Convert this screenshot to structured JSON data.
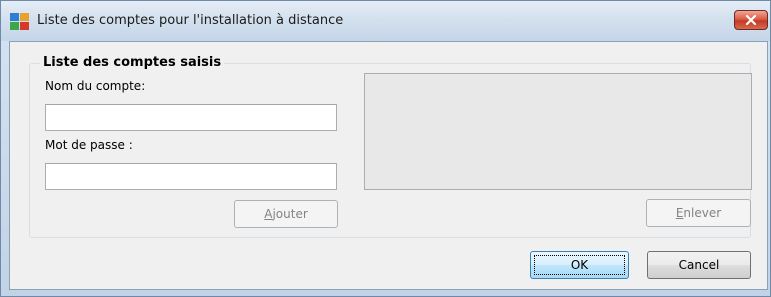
{
  "window": {
    "title": "Liste des comptes pour l'installation à distance"
  },
  "group": {
    "title": "Liste des comptes saisis"
  },
  "fields": {
    "account_label": "Nom du compte:",
    "account_value": "",
    "password_label": "Mot de passe :",
    "password_value": ""
  },
  "buttons": {
    "add": {
      "label_underlined": "A",
      "label_rest": "jouter",
      "enabled": false
    },
    "remove": {
      "label_underlined": "E",
      "label_rest": "nlever",
      "enabled": false
    },
    "ok": {
      "label": "OK"
    },
    "cancel": {
      "label": "Cancel"
    }
  },
  "accounts_list": [],
  "icons": {
    "app": "avg-logo-icon",
    "close": "close-icon"
  },
  "colors": {
    "close_button": "#d0503a",
    "default_button_border": "#3c7fb1"
  }
}
